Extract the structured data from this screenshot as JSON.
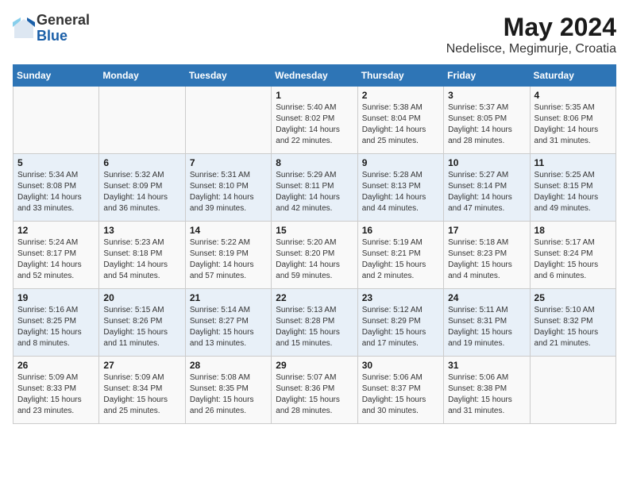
{
  "logo": {
    "general": "General",
    "blue": "Blue"
  },
  "title": "May 2024",
  "subtitle": "Nedelisce, Megimurje, Croatia",
  "days_of_week": [
    "Sunday",
    "Monday",
    "Tuesday",
    "Wednesday",
    "Thursday",
    "Friday",
    "Saturday"
  ],
  "weeks": [
    [
      {
        "day": "",
        "info": ""
      },
      {
        "day": "",
        "info": ""
      },
      {
        "day": "",
        "info": ""
      },
      {
        "day": "1",
        "info": "Sunrise: 5:40 AM\nSunset: 8:02 PM\nDaylight: 14 hours\nand 22 minutes."
      },
      {
        "day": "2",
        "info": "Sunrise: 5:38 AM\nSunset: 8:04 PM\nDaylight: 14 hours\nand 25 minutes."
      },
      {
        "day": "3",
        "info": "Sunrise: 5:37 AM\nSunset: 8:05 PM\nDaylight: 14 hours\nand 28 minutes."
      },
      {
        "day": "4",
        "info": "Sunrise: 5:35 AM\nSunset: 8:06 PM\nDaylight: 14 hours\nand 31 minutes."
      }
    ],
    [
      {
        "day": "5",
        "info": "Sunrise: 5:34 AM\nSunset: 8:08 PM\nDaylight: 14 hours\nand 33 minutes."
      },
      {
        "day": "6",
        "info": "Sunrise: 5:32 AM\nSunset: 8:09 PM\nDaylight: 14 hours\nand 36 minutes."
      },
      {
        "day": "7",
        "info": "Sunrise: 5:31 AM\nSunset: 8:10 PM\nDaylight: 14 hours\nand 39 minutes."
      },
      {
        "day": "8",
        "info": "Sunrise: 5:29 AM\nSunset: 8:11 PM\nDaylight: 14 hours\nand 42 minutes."
      },
      {
        "day": "9",
        "info": "Sunrise: 5:28 AM\nSunset: 8:13 PM\nDaylight: 14 hours\nand 44 minutes."
      },
      {
        "day": "10",
        "info": "Sunrise: 5:27 AM\nSunset: 8:14 PM\nDaylight: 14 hours\nand 47 minutes."
      },
      {
        "day": "11",
        "info": "Sunrise: 5:25 AM\nSunset: 8:15 PM\nDaylight: 14 hours\nand 49 minutes."
      }
    ],
    [
      {
        "day": "12",
        "info": "Sunrise: 5:24 AM\nSunset: 8:17 PM\nDaylight: 14 hours\nand 52 minutes."
      },
      {
        "day": "13",
        "info": "Sunrise: 5:23 AM\nSunset: 8:18 PM\nDaylight: 14 hours\nand 54 minutes."
      },
      {
        "day": "14",
        "info": "Sunrise: 5:22 AM\nSunset: 8:19 PM\nDaylight: 14 hours\nand 57 minutes."
      },
      {
        "day": "15",
        "info": "Sunrise: 5:20 AM\nSunset: 8:20 PM\nDaylight: 14 hours\nand 59 minutes."
      },
      {
        "day": "16",
        "info": "Sunrise: 5:19 AM\nSunset: 8:21 PM\nDaylight: 15 hours\nand 2 minutes."
      },
      {
        "day": "17",
        "info": "Sunrise: 5:18 AM\nSunset: 8:23 PM\nDaylight: 15 hours\nand 4 minutes."
      },
      {
        "day": "18",
        "info": "Sunrise: 5:17 AM\nSunset: 8:24 PM\nDaylight: 15 hours\nand 6 minutes."
      }
    ],
    [
      {
        "day": "19",
        "info": "Sunrise: 5:16 AM\nSunset: 8:25 PM\nDaylight: 15 hours\nand 8 minutes."
      },
      {
        "day": "20",
        "info": "Sunrise: 5:15 AM\nSunset: 8:26 PM\nDaylight: 15 hours\nand 11 minutes."
      },
      {
        "day": "21",
        "info": "Sunrise: 5:14 AM\nSunset: 8:27 PM\nDaylight: 15 hours\nand 13 minutes."
      },
      {
        "day": "22",
        "info": "Sunrise: 5:13 AM\nSunset: 8:28 PM\nDaylight: 15 hours\nand 15 minutes."
      },
      {
        "day": "23",
        "info": "Sunrise: 5:12 AM\nSunset: 8:29 PM\nDaylight: 15 hours\nand 17 minutes."
      },
      {
        "day": "24",
        "info": "Sunrise: 5:11 AM\nSunset: 8:31 PM\nDaylight: 15 hours\nand 19 minutes."
      },
      {
        "day": "25",
        "info": "Sunrise: 5:10 AM\nSunset: 8:32 PM\nDaylight: 15 hours\nand 21 minutes."
      }
    ],
    [
      {
        "day": "26",
        "info": "Sunrise: 5:09 AM\nSunset: 8:33 PM\nDaylight: 15 hours\nand 23 minutes."
      },
      {
        "day": "27",
        "info": "Sunrise: 5:09 AM\nSunset: 8:34 PM\nDaylight: 15 hours\nand 25 minutes."
      },
      {
        "day": "28",
        "info": "Sunrise: 5:08 AM\nSunset: 8:35 PM\nDaylight: 15 hours\nand 26 minutes."
      },
      {
        "day": "29",
        "info": "Sunrise: 5:07 AM\nSunset: 8:36 PM\nDaylight: 15 hours\nand 28 minutes."
      },
      {
        "day": "30",
        "info": "Sunrise: 5:06 AM\nSunset: 8:37 PM\nDaylight: 15 hours\nand 30 minutes."
      },
      {
        "day": "31",
        "info": "Sunrise: 5:06 AM\nSunset: 8:38 PM\nDaylight: 15 hours\nand 31 minutes."
      },
      {
        "day": "",
        "info": ""
      }
    ]
  ]
}
